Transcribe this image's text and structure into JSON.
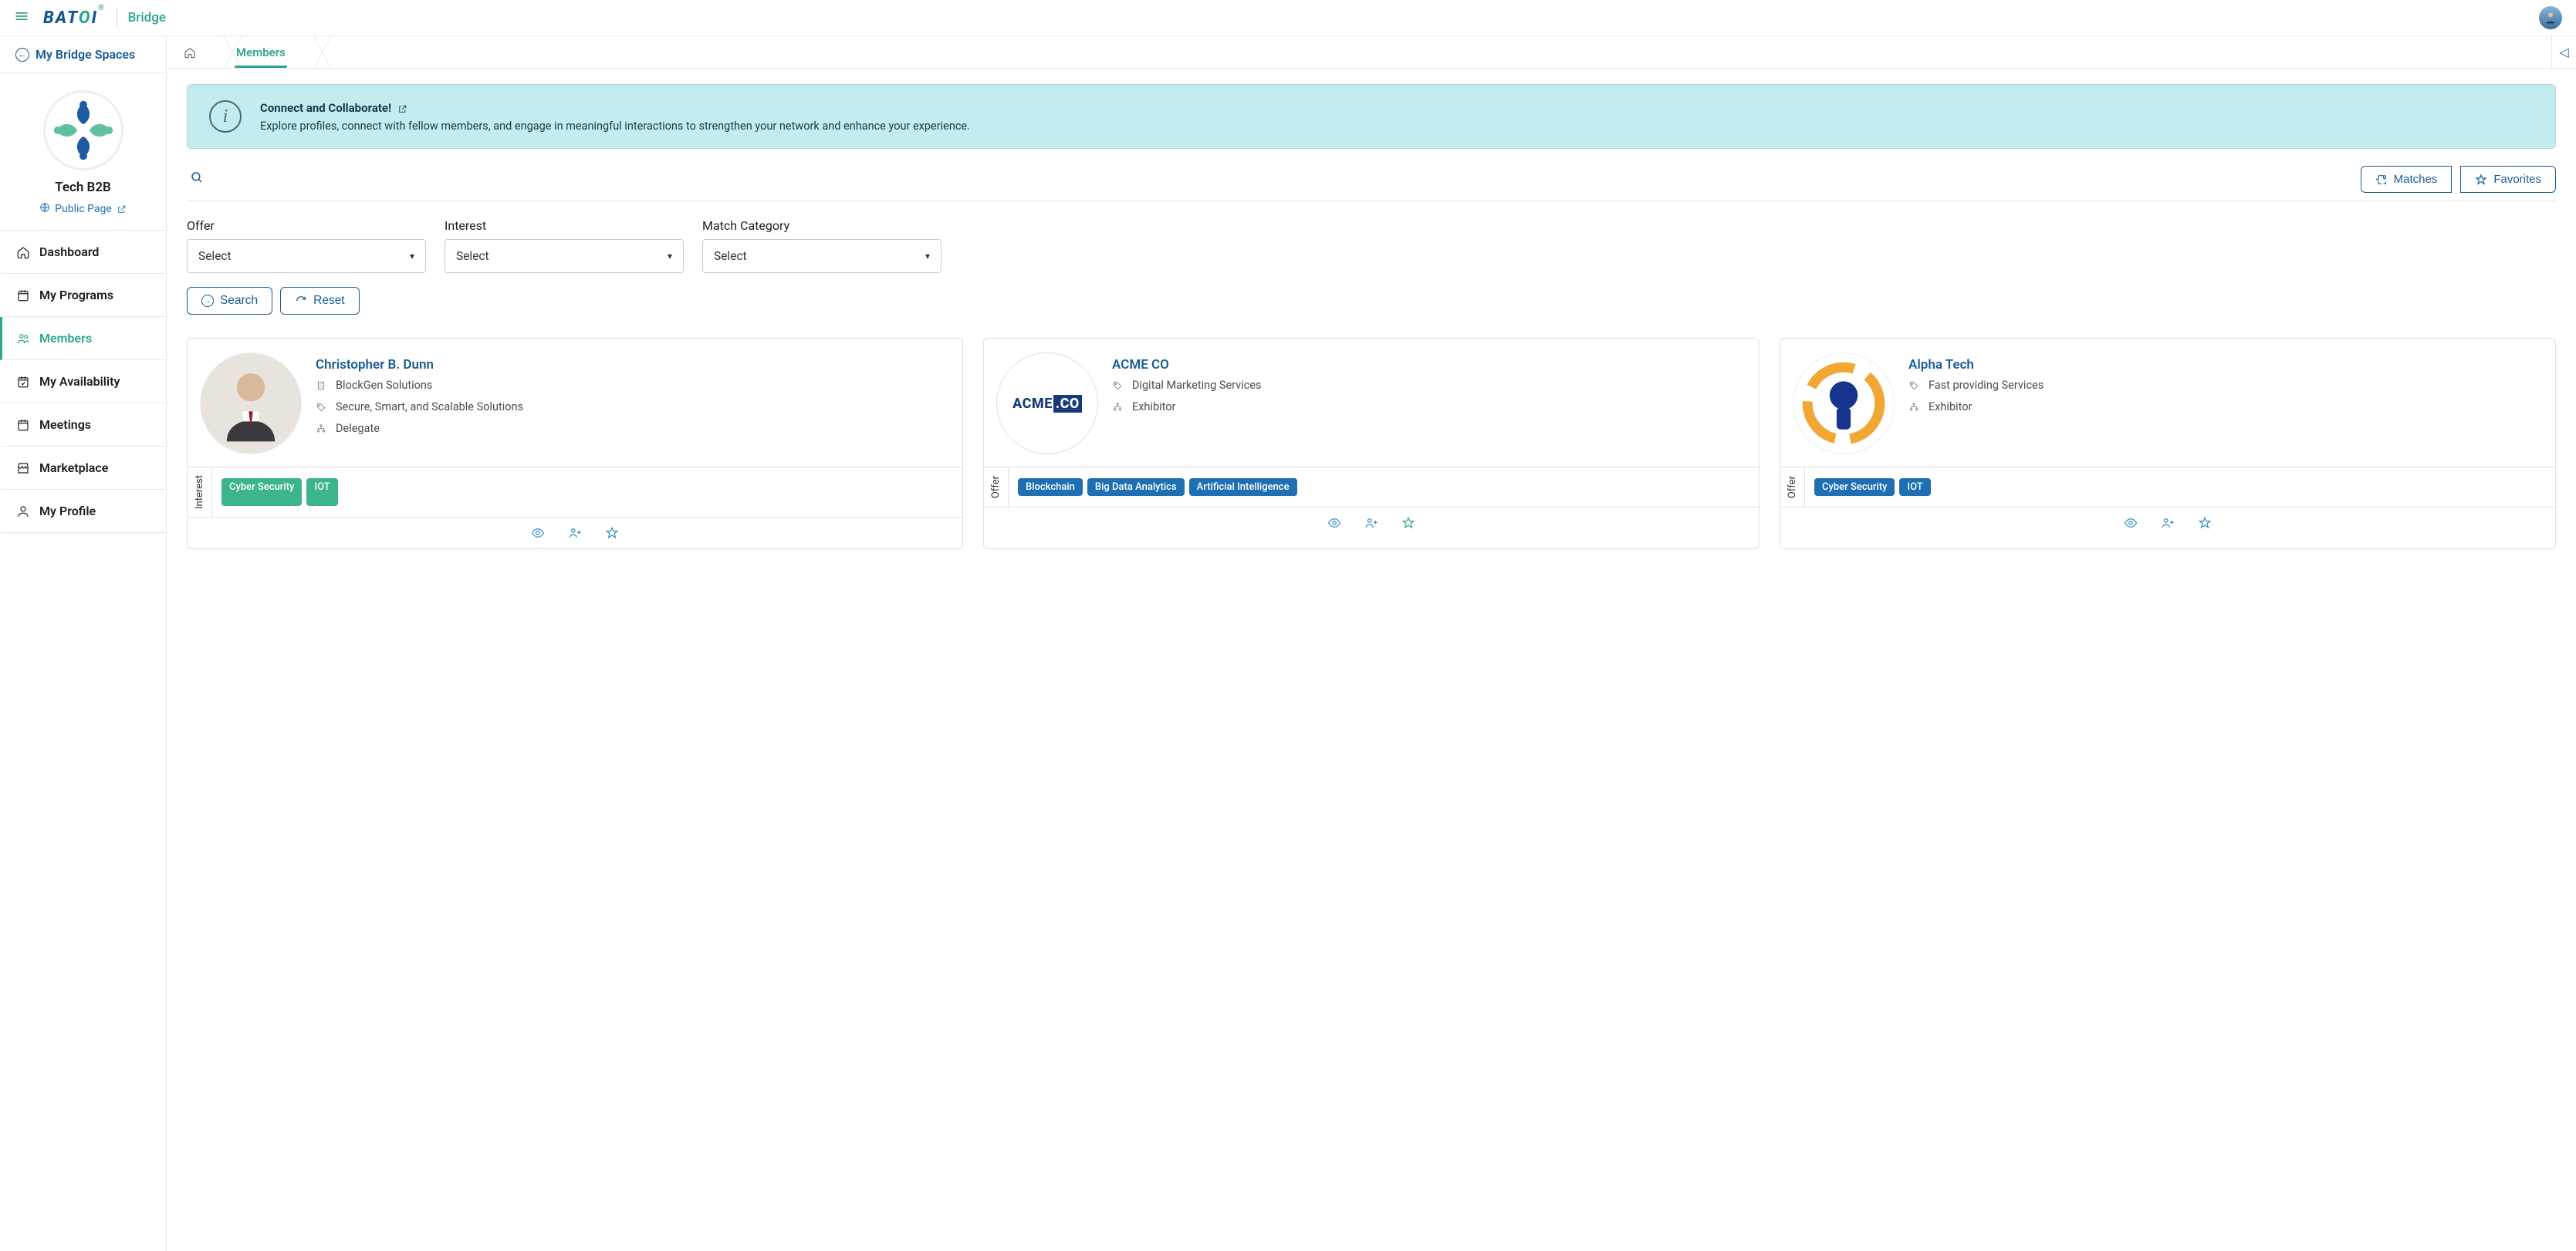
{
  "app": {
    "name": "Bridge",
    "logo": "BATOI"
  },
  "sidebar": {
    "back_label": "My Bridge Spaces",
    "org": {
      "name": "Tech B2B",
      "public_link": "Public Page"
    },
    "items": [
      {
        "label": "Dashboard",
        "icon": "home"
      },
      {
        "label": "My Programs",
        "icon": "calendar"
      },
      {
        "label": "Members",
        "icon": "users",
        "active": true
      },
      {
        "label": "My Availability",
        "icon": "calendar-check"
      },
      {
        "label": "Meetings",
        "icon": "calendar"
      },
      {
        "label": "Marketplace",
        "icon": "store"
      },
      {
        "label": "My Profile",
        "icon": "user"
      }
    ]
  },
  "breadcrumb": {
    "current": "Members"
  },
  "banner": {
    "title": "Connect and Collaborate!",
    "desc": "Explore profiles, connect with fellow members, and engage in meaningful interactions to strengthen your network and enhance your experience."
  },
  "toolbar": {
    "matches": "Matches",
    "favorites": "Favorites"
  },
  "filters": {
    "offer_label": "Offer",
    "interest_label": "Interest",
    "match_label": "Match Category",
    "select_placeholder": "Select"
  },
  "actions": {
    "search": "Search",
    "reset": "Reset"
  },
  "members": [
    {
      "name": "Christopher B. Dunn",
      "company": "BlockGen Solutions",
      "tagline": "Secure, Smart, and Scalable Solutions",
      "role": "Delegate",
      "tag_type": "Interest",
      "tag_style": "green",
      "tags": [
        "Cyber Security",
        "IOT"
      ],
      "fav": false
    },
    {
      "name": "ACME CO",
      "company": null,
      "tagline": "Digital Marketing Services",
      "role": "Exhibitor",
      "tag_type": "Offer",
      "tag_style": "blue",
      "tags": [
        "Blockchain",
        "Big Data Analytics",
        "Artificial Intelligence"
      ],
      "fav": true
    },
    {
      "name": "Alpha Tech",
      "company": null,
      "tagline": "Fast providing Services",
      "role": "Exhibitor",
      "tag_type": "Offer",
      "tag_style": "blue",
      "tags": [
        "Cyber Security",
        "IOT"
      ],
      "fav": false
    }
  ]
}
